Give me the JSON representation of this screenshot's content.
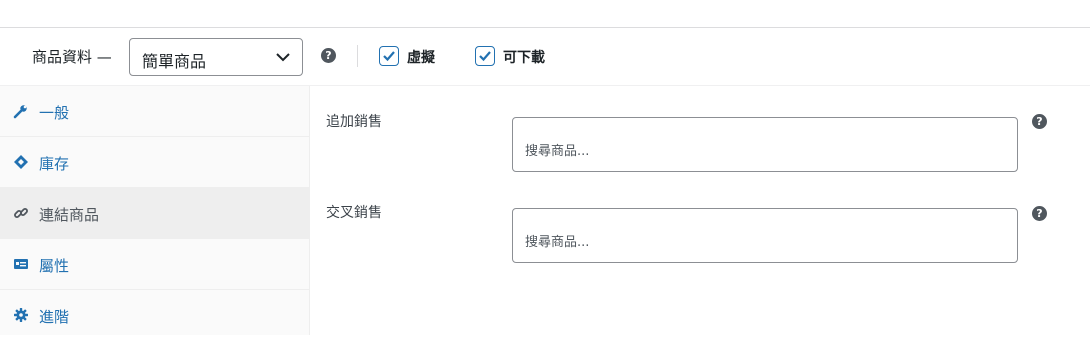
{
  "header": {
    "title": "商品資料 —",
    "product_type": "簡單商品",
    "help_icon": "question-circle-icon",
    "options": [
      {
        "label": "虛擬",
        "checked": true
      },
      {
        "label": "可下載",
        "checked": true
      }
    ]
  },
  "tabs": [
    {
      "label": "一般",
      "icon": "wrench-icon",
      "active": false
    },
    {
      "label": "庫存",
      "icon": "tag-icon",
      "active": false
    },
    {
      "label": "連結商品",
      "icon": "link-icon",
      "active": true
    },
    {
      "label": "屬性",
      "icon": "list-card-icon",
      "active": false
    },
    {
      "label": "進階",
      "icon": "gear-icon",
      "active": false
    }
  ],
  "fields": [
    {
      "label": "追加銷售",
      "placeholder": "搜尋商品..."
    },
    {
      "label": "交叉銷售",
      "placeholder": "搜尋商品..."
    }
  ],
  "colors": {
    "accent": "#2271b1",
    "active_tab_bg": "#eeeeee",
    "help_icon": "#50575e"
  }
}
